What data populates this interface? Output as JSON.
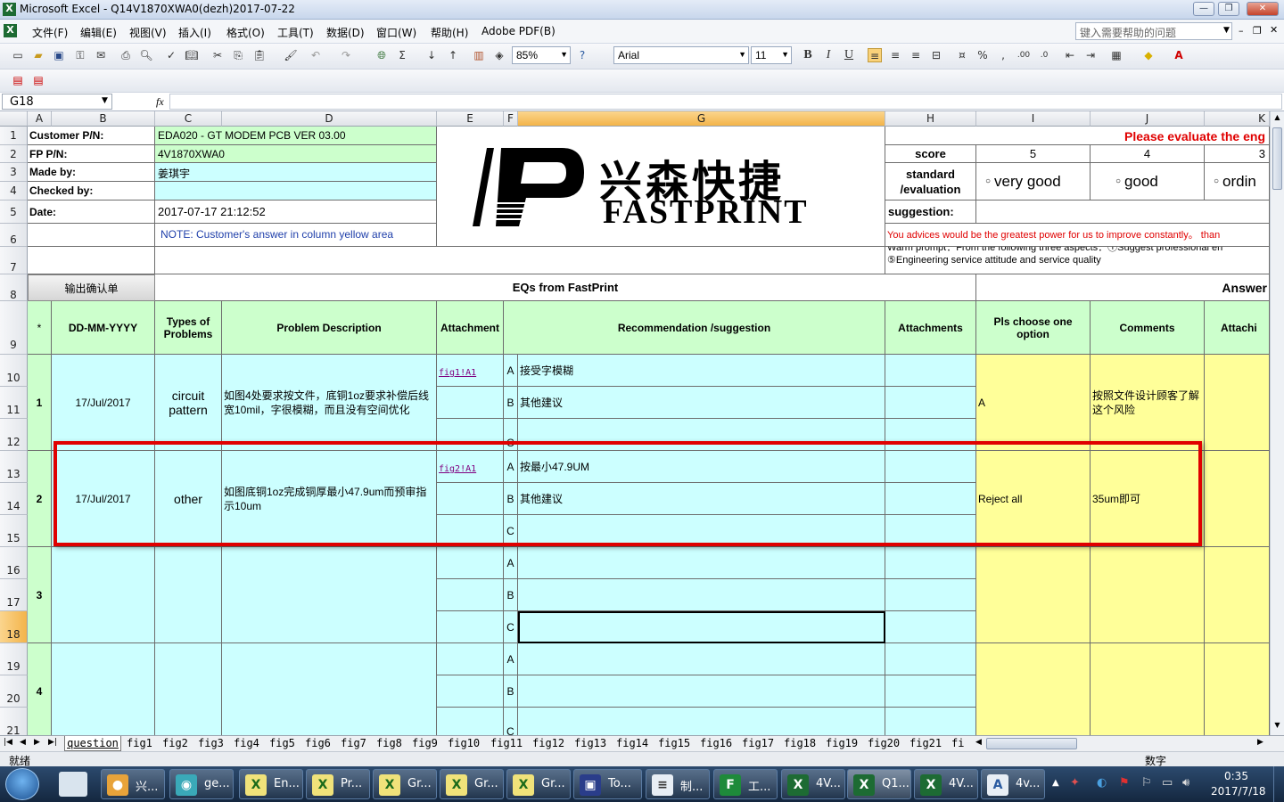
{
  "window": {
    "title": "Microsoft Excel - Q14V1870XWA0(dezh)2017-07-22"
  },
  "menu": [
    "文件(F)",
    "编辑(E)",
    "视图(V)",
    "插入(I)",
    "格式(O)",
    "工具(T)",
    "数据(D)",
    "窗口(W)",
    "帮助(H)",
    "Adobe PDF(B)"
  ],
  "help_placeholder": "键入需要帮助的问题",
  "toolbar": {
    "zoom": "85%",
    "font": "Arial",
    "size": "11",
    "bold": "B",
    "italic": "I",
    "underline": "U"
  },
  "namebox": "G18",
  "fx": "fx",
  "columns": [
    "A",
    "B",
    "C",
    "D",
    "E",
    "F",
    "G",
    "H",
    "I",
    "J",
    "K"
  ],
  "rows": [
    "1",
    "2",
    "3",
    "4",
    "5",
    "6",
    "7",
    "8",
    "9",
    "10",
    "11",
    "12",
    "13",
    "14",
    "15",
    "16",
    "17",
    "18",
    "19",
    "20",
    "21"
  ],
  "header": {
    "customer_pn_label": "Customer P/N:",
    "customer_pn": "EDA020 - GT MODEM PCB VER 03.00",
    "fp_pn_label": "FP P/N:",
    "fp_pn": "4V1870XWA0",
    "made_by_label": "Made by:",
    "made_by": "姜琪宇",
    "checked_by_label": "Checked by:",
    "date_label": "Date:",
    "date": "2017-07-17 21:12:52",
    "note": "NOTE: Customer's  answer in column yellow area",
    "logo_cn": "兴森快捷",
    "logo_en": "FASTPRINT",
    "please": "Please evaluate the eng",
    "score_label": "score",
    "score_5": "5",
    "score_4": "4",
    "score_3": "3",
    "standard": "standard",
    "evaluation": "/evaluation",
    "opt_very_good": "very good",
    "opt_good": "good",
    "opt_ord": "ordin",
    "suggestion": "suggestion:",
    "advice": "You advices would be the greatest power for us to improve constantly。 than",
    "warm": "Warm prompt：From the following three aspects：①Suggest professional en",
    "service": "⑤Engineering service attitude and service quality",
    "output_btn": "输出确认单",
    "eqs": "EQs from FastPrint",
    "answer": "Answer"
  },
  "table_headers": {
    "star": "*",
    "date": "DD-MM-YYYY",
    "types": "Types of Problems",
    "problem": "Problem Description",
    "attachment": "Attachment",
    "recommend": "Recommendation /suggestion",
    "attachments": "Attachments",
    "choose": "Pls choose one option",
    "comments": "Comments",
    "attach2": "Attachi"
  },
  "eqs": [
    {
      "no": "1",
      "date": "17/Jul/2017",
      "type": "circuit pattern",
      "problem": "如图4处要求按文件，底铜1oz要求补偿后线宽10mil，字很模糊，而且没有空间优化",
      "link": "fig1!A1",
      "A": "接受字模糊",
      "B": "其他建议",
      "C": "",
      "choice": "A",
      "comment": "按照文件设计顾客了解这个风险"
    },
    {
      "no": "2",
      "date": "17/Jul/2017",
      "type": "other",
      "problem": "如图底铜1oz完成铜厚最小47.9um而预审指示10um",
      "link": "fig2!A1",
      "A": "按最小47.9UM",
      "B": "其他建议",
      "C": "",
      "choice": "Reject all",
      "comment": "35um即可"
    },
    {
      "no": "3",
      "date": "",
      "type": "",
      "problem": "",
      "link": "",
      "A": "",
      "B": "",
      "C": "",
      "choice": "",
      "comment": ""
    },
    {
      "no": "4",
      "date": "",
      "type": "",
      "problem": "",
      "link": "",
      "A": "",
      "B": "",
      "C": "",
      "choice": "",
      "comment": ""
    }
  ],
  "abc": [
    "A",
    "B",
    "C"
  ],
  "sheet_tabs": [
    "question",
    "fig1",
    "fig2",
    "fig3",
    "fig4",
    "fig5",
    "fig6",
    "fig7",
    "fig8",
    "fig9",
    "fig10",
    "fig11",
    "fig12",
    "fig13",
    "fig14",
    "fig15",
    "fig16",
    "fig17",
    "fig18",
    "fig19",
    "fig20",
    "fig21",
    "fi"
  ],
  "status": {
    "ready": "就绪",
    "mode": "数字"
  },
  "taskbar": {
    "items": [
      "兴...",
      "ge...",
      "En...",
      "Pr...",
      "Gr...",
      "Gr...",
      "Gr...",
      "To...",
      "制...",
      "工...",
      "4V...",
      "Q1...",
      "4V...",
      "4v..."
    ],
    "time": "0:35",
    "date": "2017/7/18"
  }
}
